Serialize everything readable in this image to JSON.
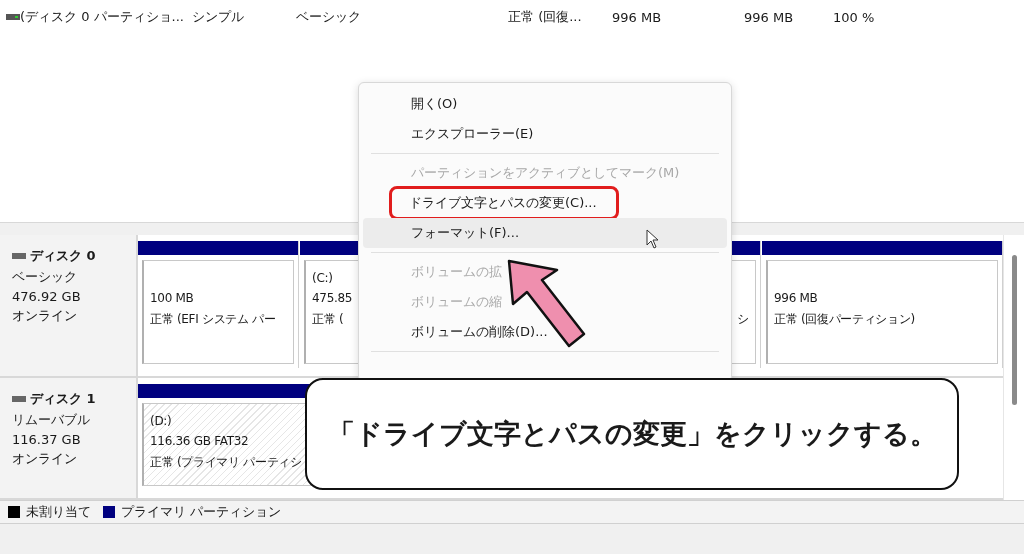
{
  "volume_list": {
    "rows": [
      {
        "cells": [
          "(ディスク 0 パーティショ...",
          "シンプル",
          "ベーシック",
          "正常 (回復...",
          "996 MB",
          "996 MB",
          "100 %"
        ]
      }
    ]
  },
  "disks": [
    {
      "name": "ディスク 0",
      "type": "ベーシック",
      "size": "476.92 GB",
      "status": "オンライン",
      "partitions": [
        {
          "kind": "plain",
          "size": "100 MB",
          "status": "正常 (EFI システム パー"
        },
        {
          "kind": "plain",
          "label": "(C:)",
          "size": "475.85",
          "status": "正常 ("
        },
        {
          "kind": "plain",
          "status": "シ"
        },
        {
          "kind": "plain",
          "size": "996 MB",
          "status": "正常 (回復パーティション)"
        }
      ]
    },
    {
      "name": "ディスク 1",
      "type": "リムーバブル",
      "size": "116.37 GB",
      "status": "オンライン",
      "partitions": [
        {
          "kind": "hatched",
          "label": "(D:)",
          "size": "116.36 GB FAT32",
          "status": "正常 (プライマリ パーティシ"
        }
      ]
    }
  ],
  "legend": [
    {
      "label": "未割り当て",
      "color": "#000000"
    },
    {
      "label": "プライマリ パーティション",
      "color": "#00007f"
    }
  ],
  "context_menu": {
    "items": [
      {
        "kind": "item",
        "label": "開く(O)",
        "disabled": false,
        "hovered": false,
        "highlighted": false
      },
      {
        "kind": "item",
        "label": "エクスプローラー(E)",
        "disabled": false,
        "hovered": false,
        "highlighted": false
      },
      {
        "kind": "separator"
      },
      {
        "kind": "item",
        "label": "パーティションをアクティブとしてマーク(M)",
        "disabled": true,
        "hovered": false,
        "highlighted": false
      },
      {
        "kind": "item",
        "label": "ドライブ文字とパスの変更(C)...",
        "disabled": false,
        "hovered": false,
        "highlighted": true
      },
      {
        "kind": "item",
        "label": "フォーマット(F)...",
        "disabled": false,
        "hovered": true,
        "highlighted": false
      },
      {
        "kind": "separator"
      },
      {
        "kind": "item",
        "label": "ボリュームの拡",
        "disabled": true,
        "hovered": false,
        "highlighted": false
      },
      {
        "kind": "item",
        "label": "ボリュームの縮",
        "disabled": true,
        "hovered": false,
        "highlighted": false
      },
      {
        "kind": "item",
        "label": "ボリュームの削除(D)...",
        "disabled": false,
        "hovered": false,
        "highlighted": false
      },
      {
        "kind": "separator"
      }
    ]
  },
  "callout": {
    "text": "「ドライブ文字とパスの変更」をクリックする。"
  }
}
